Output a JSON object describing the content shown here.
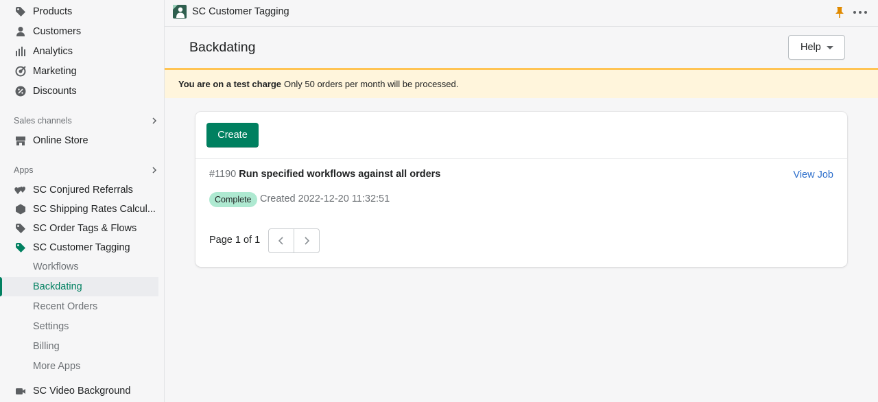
{
  "sidebar": {
    "main_items": [
      {
        "label": "Products",
        "icon": "tag-icon"
      },
      {
        "label": "Customers",
        "icon": "person-icon"
      },
      {
        "label": "Analytics",
        "icon": "bar-chart-icon"
      },
      {
        "label": "Marketing",
        "icon": "target-icon"
      },
      {
        "label": "Discounts",
        "icon": "discount-icon"
      }
    ],
    "sales_channels_heading": "Sales channels",
    "online_store": "Online Store",
    "apps_heading": "Apps",
    "apps": [
      {
        "label": "SC Conjured Referrals"
      },
      {
        "label": "SC Shipping Rates Calcul..."
      },
      {
        "label": "SC Order Tags & Flows"
      },
      {
        "label": "SC Customer Tagging"
      }
    ],
    "sub_items": [
      {
        "label": "Workflows",
        "active": false
      },
      {
        "label": "Backdating",
        "active": true
      },
      {
        "label": "Recent Orders",
        "active": false
      },
      {
        "label": "Settings",
        "active": false
      },
      {
        "label": "Billing",
        "active": false
      },
      {
        "label": "More Apps",
        "active": false
      }
    ],
    "video_app": "SC Video Background"
  },
  "topbar": {
    "app_title": "SC Customer Tagging"
  },
  "page": {
    "title": "Backdating",
    "help_label": "Help"
  },
  "banner": {
    "bold": "You are on a test charge",
    "text": "Only 50 orders per month will be processed."
  },
  "card": {
    "create_label": "Create",
    "job": {
      "id": "#1190",
      "title": "Run specified workflows against all orders",
      "view_label": "View Job",
      "status": "Complete",
      "created": "Created 2022-12-20 11:32:51"
    },
    "pagination": "Page 1 of 1"
  },
  "colors": {
    "accent": "#008060",
    "link": "#2c6ecb",
    "banner_bg": "#fff5dc",
    "banner_border": "#ffc453",
    "badge_bg": "#aee9d1"
  }
}
